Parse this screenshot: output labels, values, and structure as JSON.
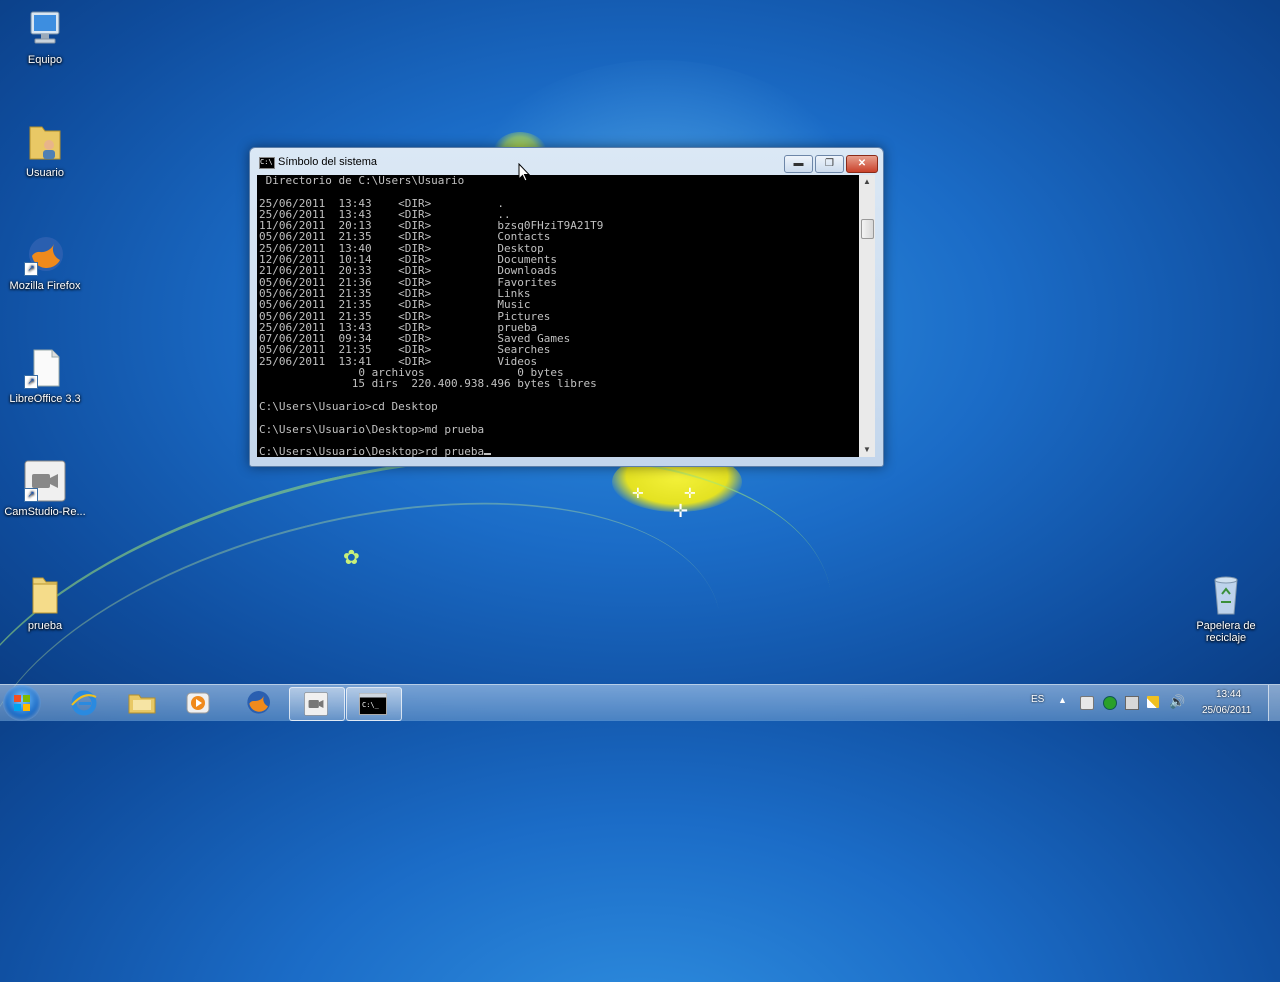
{
  "desktop": {
    "icons": [
      {
        "label": "Equipo",
        "icon": "computer-icon"
      },
      {
        "label": "Usuario",
        "icon": "user-folder-icon"
      },
      {
        "label": "Mozilla Firefox",
        "icon": "firefox-icon"
      },
      {
        "label": "LibreOffice 3.3",
        "icon": "libreoffice-icon"
      },
      {
        "label": "CamStudio-Re...",
        "icon": "camstudio-icon"
      },
      {
        "label": "prueba",
        "icon": "folder-icon"
      },
      {
        "label": "Papelera de reciclaje",
        "icon": "recycle-bin-icon"
      }
    ]
  },
  "window": {
    "title": "Símbolo del sistema",
    "minimize_label": "▬",
    "maximize_label": "❐",
    "close_label": "✕",
    "console_lines": [
      " Directorio de C:\\Users\\Usuario",
      "",
      "25/06/2011  13:43    <DIR>          .",
      "25/06/2011  13:43    <DIR>          ..",
      "11/06/2011  20:13    <DIR>          bzsq0FHziT9A21T9",
      "05/06/2011  21:35    <DIR>          Contacts",
      "25/06/2011  13:40    <DIR>          Desktop",
      "12/06/2011  10:14    <DIR>          Documents",
      "21/06/2011  20:33    <DIR>          Downloads",
      "05/06/2011  21:36    <DIR>          Favorites",
      "05/06/2011  21:35    <DIR>          Links",
      "05/06/2011  21:35    <DIR>          Music",
      "05/06/2011  21:35    <DIR>          Pictures",
      "25/06/2011  13:43    <DIR>          prueba",
      "07/06/2011  09:34    <DIR>          Saved Games",
      "05/06/2011  21:35    <DIR>          Searches",
      "25/06/2011  13:41    <DIR>          Videos",
      "               0 archivos              0 bytes",
      "              15 dirs  220.400.938.496 bytes libres",
      "",
      "C:\\Users\\Usuario>cd Desktop",
      "",
      "C:\\Users\\Usuario\\Desktop>md prueba",
      ""
    ],
    "prompt_line": "C:\\Users\\Usuario\\Desktop>rd prueba"
  },
  "taskbar": {
    "buttons": [
      {
        "name": "internet-explorer-icon",
        "active": false
      },
      {
        "name": "file-explorer-icon",
        "active": false
      },
      {
        "name": "media-player-icon",
        "active": false
      },
      {
        "name": "firefox-icon",
        "active": false
      },
      {
        "name": "camstudio-icon",
        "active": true
      },
      {
        "name": "command-prompt-icon",
        "active": true
      }
    ],
    "language": "ES",
    "time": "13:44",
    "date": "25/06/2011"
  },
  "colors": {
    "console_bg": "#000000",
    "console_fg": "#c0c0c0",
    "desktop_blue": "#1b6cc7"
  }
}
